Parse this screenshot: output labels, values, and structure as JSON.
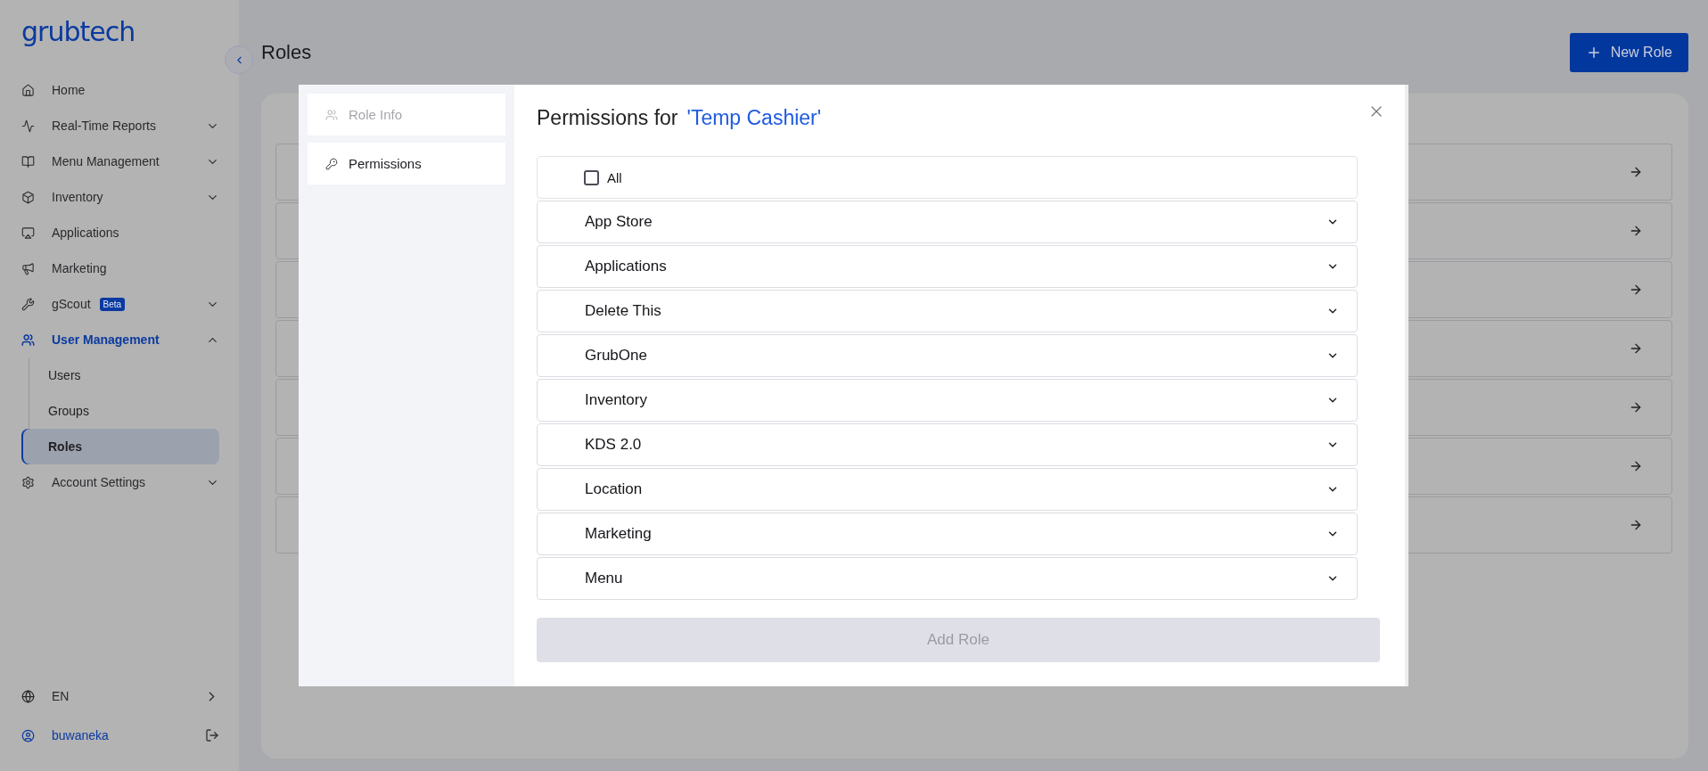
{
  "brand": {
    "logo": "grubtech"
  },
  "sidebar": {
    "items": [
      {
        "label": "Home",
        "selected": false
      },
      {
        "label": "Real-Time Reports",
        "expanded": false,
        "selected": false
      },
      {
        "label": "Menu Management",
        "expanded": false,
        "selected": false
      },
      {
        "label": "Inventory",
        "expanded": false,
        "selected": false
      },
      {
        "label": "Applications",
        "selected": false
      },
      {
        "label": "Marketing",
        "selected": false
      },
      {
        "label": "gScout",
        "badge": "Beta",
        "expanded": false,
        "selected": false
      },
      {
        "label": "User Management",
        "expanded": true,
        "selected": true,
        "children": [
          {
            "label": "Users",
            "selected": false
          },
          {
            "label": "Groups",
            "selected": false
          },
          {
            "label": "Roles",
            "selected": true
          }
        ]
      },
      {
        "label": "Account Settings",
        "expanded": false,
        "selected": false
      }
    ],
    "language": "EN",
    "user": "buwaneka"
  },
  "page": {
    "title": "Roles",
    "new_button": "New Role"
  },
  "modal": {
    "tabs": [
      {
        "label": "Role Info",
        "selected": false
      },
      {
        "label": "Permissions",
        "selected": true
      }
    ],
    "title": "Permissions for",
    "role_name": "'Temp Cashier'",
    "all": {
      "label": "All",
      "checked": false
    },
    "groups": [
      {
        "label": "App Store",
        "expanded": false
      },
      {
        "label": "Applications",
        "expanded": false
      },
      {
        "label": "Delete This",
        "expanded": false
      },
      {
        "label": "GrubOne",
        "expanded": false
      },
      {
        "label": "Inventory",
        "expanded": false
      },
      {
        "label": "KDS 2.0",
        "expanded": false
      },
      {
        "label": "Location",
        "expanded": false
      },
      {
        "label": "Marketing",
        "expanded": false
      },
      {
        "label": "Menu",
        "expanded": false
      }
    ],
    "submit": {
      "label": "Add Role",
      "disabled": true
    }
  }
}
